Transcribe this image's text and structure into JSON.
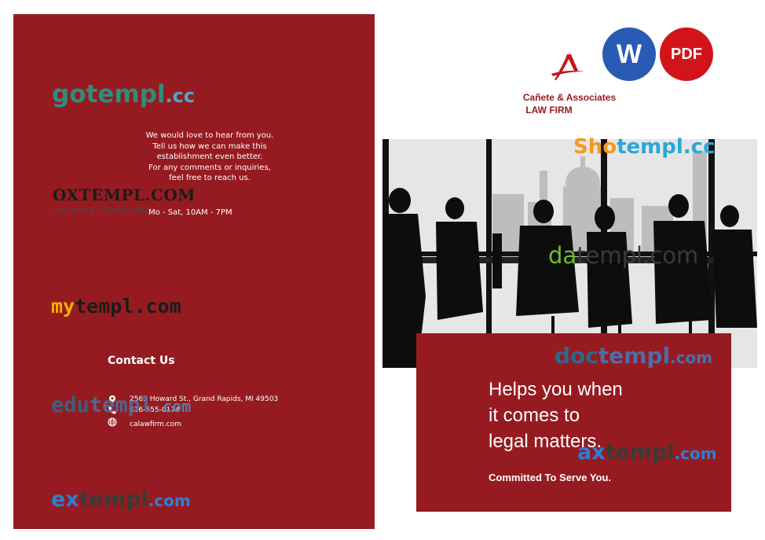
{
  "watermarks": {
    "gotempl": {
      "part1": "gotempl",
      "part2": ".cc"
    },
    "oxtempl": {
      "name": "OXTEMPL.COM",
      "tagline": "WE MAKE TEMPLATES"
    },
    "mytempl": {
      "part1": "my",
      "part2": "templ.com"
    },
    "edutempl": {
      "part1": "edu",
      "part2": "templ",
      "part3": ".com"
    },
    "extempl": {
      "part1": "ex",
      "part2": "templ",
      "part3": ".com"
    },
    "shotempl": {
      "part1": "Sho",
      "part2": "templ",
      "part3": ".cc"
    },
    "datempl": {
      "part1": "da",
      "part2": "templ.com"
    },
    "doctempl": {
      "part1": "doc",
      "part2": "templ",
      "part3": ".com"
    },
    "axtempl": {
      "part1": "ax",
      "part2": "templ",
      "part3": ".com"
    }
  },
  "left_panel": {
    "intro_lines": [
      "We would love to hear from you.",
      "Tell us how we can make this",
      "establishment even better.",
      "For any comments or inquiries,",
      "feel free to reach us."
    ],
    "hours": "Mo - Sat, 10AM - 7PM",
    "contact_title": "Contact Us",
    "address": "2565 Howard St., Grand Rapids, MI 49503",
    "phone": "616-555-0174",
    "website": "calawfirm.com"
  },
  "header": {
    "firm_name": "Cañete & Associates",
    "firm_sub": "LAW FIRM",
    "word_badge": "W",
    "pdf_badge": "PDF"
  },
  "cta": {
    "headline_lines": [
      "Helps you when",
      "it comes to",
      "legal matters."
    ],
    "tagline": "Committed To Serve You."
  },
  "colors": {
    "brand_red": "#961b20",
    "word_blue": "#2a5bb4",
    "pdf_red": "#d2141a"
  }
}
